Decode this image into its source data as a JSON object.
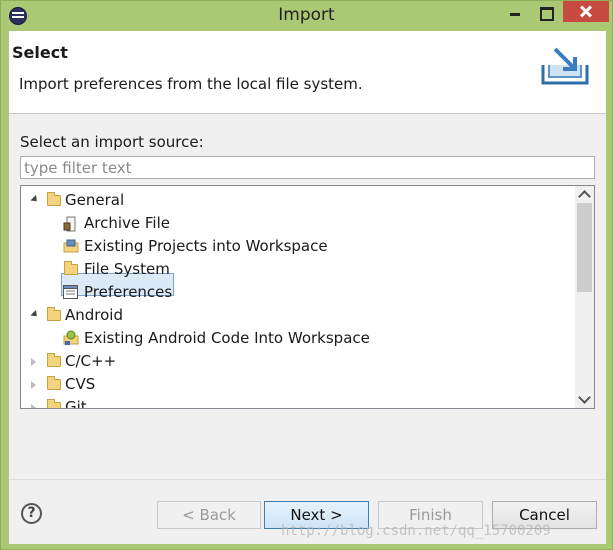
{
  "window": {
    "title": "Import"
  },
  "header": {
    "title": "Select",
    "description": "Import preferences from the local file system."
  },
  "main": {
    "source_label": "Select an import source:",
    "filter_placeholder": "type filter text",
    "tree": [
      {
        "label": "General",
        "level": 0,
        "expanded": true,
        "icon": "folder-icon"
      },
      {
        "label": "Archive File",
        "level": 1,
        "icon": "archive-file-icon"
      },
      {
        "label": "Existing Projects into Workspace",
        "level": 1,
        "icon": "projects-folder-icon"
      },
      {
        "label": "File System",
        "level": 1,
        "icon": "folder-icon"
      },
      {
        "label": "Preferences",
        "level": 1,
        "icon": "preferences-icon",
        "selected": true
      },
      {
        "label": "Android",
        "level": 0,
        "expanded": true,
        "icon": "folder-icon"
      },
      {
        "label": "Existing Android Code Into Workspace",
        "level": 1,
        "icon": "android-import-icon"
      },
      {
        "label": "C/C++",
        "level": 0,
        "expanded": false,
        "icon": "folder-icon"
      },
      {
        "label": "CVS",
        "level": 0,
        "expanded": false,
        "icon": "folder-icon"
      },
      {
        "label": "Git",
        "level": 0,
        "expanded": false,
        "icon": "folder-icon"
      }
    ]
  },
  "footer": {
    "help": "?",
    "back": "< Back",
    "next": "Next >",
    "finish": "Finish",
    "cancel": "Cancel",
    "watermark": "http://blog.csdn.net/qq_15700209"
  },
  "colors": {
    "window_frame": "#abc875",
    "close_button": "#c74a41",
    "selection": "#dceaf8"
  }
}
